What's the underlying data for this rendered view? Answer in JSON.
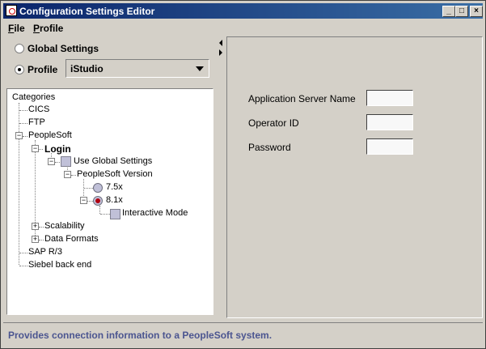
{
  "window": {
    "title": "Configuration Settings Editor",
    "controls": {
      "minimize": "_",
      "maximize": "□",
      "close": "×"
    }
  },
  "menubar": {
    "items": [
      {
        "mnemonic": "F",
        "rest": "ile"
      },
      {
        "mnemonic": "P",
        "rest": "rofile"
      }
    ]
  },
  "settings_mode": {
    "global_label": "Global Settings",
    "global_selected": false,
    "profile_label": "Profile",
    "profile_selected": true,
    "profile_value": "iStudio"
  },
  "tree": {
    "root": "Categories",
    "nodes": {
      "cics": "CICS",
      "ftp": "FTP",
      "peoplesoft": "PeopleSoft",
      "login": "Login",
      "use_global": "Use Global Settings",
      "ps_version": "PeopleSoft Version",
      "v75": "7.5x",
      "v81": "8.1x",
      "interactive": "Interactive Mode",
      "scalability": "Scalability",
      "data_formats": "Data Formats",
      "sap": "SAP R/3",
      "siebel": "Siebel back end"
    },
    "selected_version": "8.1x"
  },
  "form": {
    "fields": [
      {
        "label": "Application Server Name",
        "value": ""
      },
      {
        "label": "Operator ID",
        "value": ""
      },
      {
        "label": "Password",
        "value": ""
      }
    ]
  },
  "status": {
    "message": "Provides connection information to a PeopleSoft system.",
    "color": "#4b5590"
  }
}
